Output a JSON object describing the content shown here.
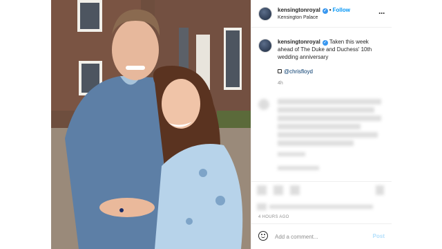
{
  "post": {
    "username": "kensingtonroyal",
    "verified_icon": "check-icon",
    "follow_label": "Follow",
    "location": "Kensington Palace",
    "more_icon": "more-options-icon"
  },
  "caption": {
    "username": "kensingtonroyal",
    "text": "Taken this week ahead of The Duke and Duchess' 10th wedding anniversary",
    "credit": "@chrisfloyd",
    "time": "4h"
  },
  "footer": {
    "timestamp": "4 HOURS AGO",
    "comment_placeholder": "Add a comment...",
    "post_label": "Post",
    "emoji_icon": "smiley-icon"
  },
  "colors": {
    "link_blue": "#0095f6",
    "verified_blue": "#3897f0",
    "post_disabled": "#b2dffc"
  }
}
